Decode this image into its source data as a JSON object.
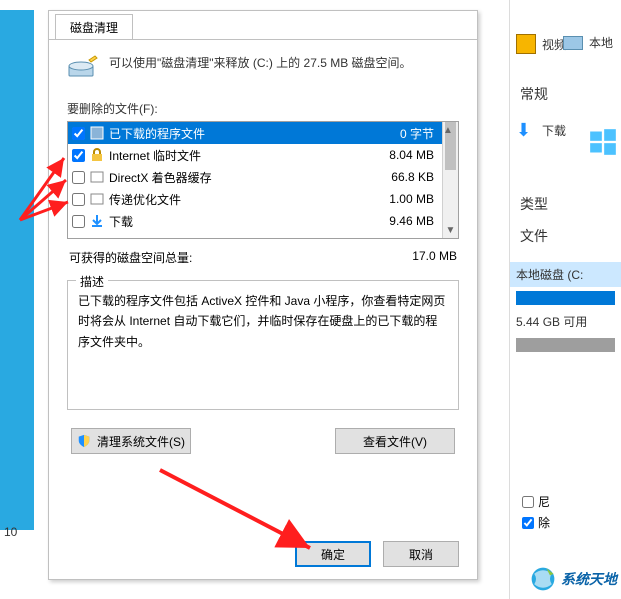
{
  "dialog": {
    "tab_label": "磁盘清理",
    "info_text": "可以使用\"磁盘清理\"来释放  (C:) 上的 27.5 MB 磁盘空间。",
    "files_to_delete_label": "要删除的文件(F):",
    "items": [
      {
        "label": "已下载的程序文件",
        "size": "0 字节",
        "checked": true,
        "selected": true,
        "icon": "program-file-icon"
      },
      {
        "label": "Internet 临时文件",
        "size": "8.04 MB",
        "checked": true,
        "selected": false,
        "icon": "lock-icon"
      },
      {
        "label": "DirectX 着色器缓存",
        "size": "66.8 KB",
        "checked": false,
        "selected": false,
        "icon": "directx-icon"
      },
      {
        "label": "传递优化文件",
        "size": "1.00 MB",
        "checked": false,
        "selected": false,
        "icon": "delivery-opt-icon"
      },
      {
        "label": "下载",
        "size": "9.46 MB",
        "checked": false,
        "selected": false,
        "icon": "download-icon"
      }
    ],
    "total_label": "可获得的磁盘空间总量:",
    "total_value": "17.0 MB",
    "description": {
      "legend": "描述",
      "text": "已下载的程序文件包括 ActiveX 控件和 Java 小程序，你查看特定网页时将会从 Internet 自动下载它们，并临时保存在硬盘上的已下载的程序文件夹中。"
    },
    "clean_system_button": "清理系统文件(S)",
    "view_files_button": "查看文件(V)",
    "ok_button": "确定",
    "cancel_button": "取消"
  },
  "right_panel": {
    "video_label": "视频",
    "local_fragment": "本地",
    "general_tab": "常规",
    "downloads_label": "下载",
    "type_label": "类型",
    "file_label": "文件",
    "local_disk": "本地磁盘 (C:",
    "capacity": "5.44 GB 可用",
    "chk_p": "尼",
    "chk_b": "除"
  },
  "background": {
    "left_number": "10"
  },
  "footer_brand": "系统天地"
}
